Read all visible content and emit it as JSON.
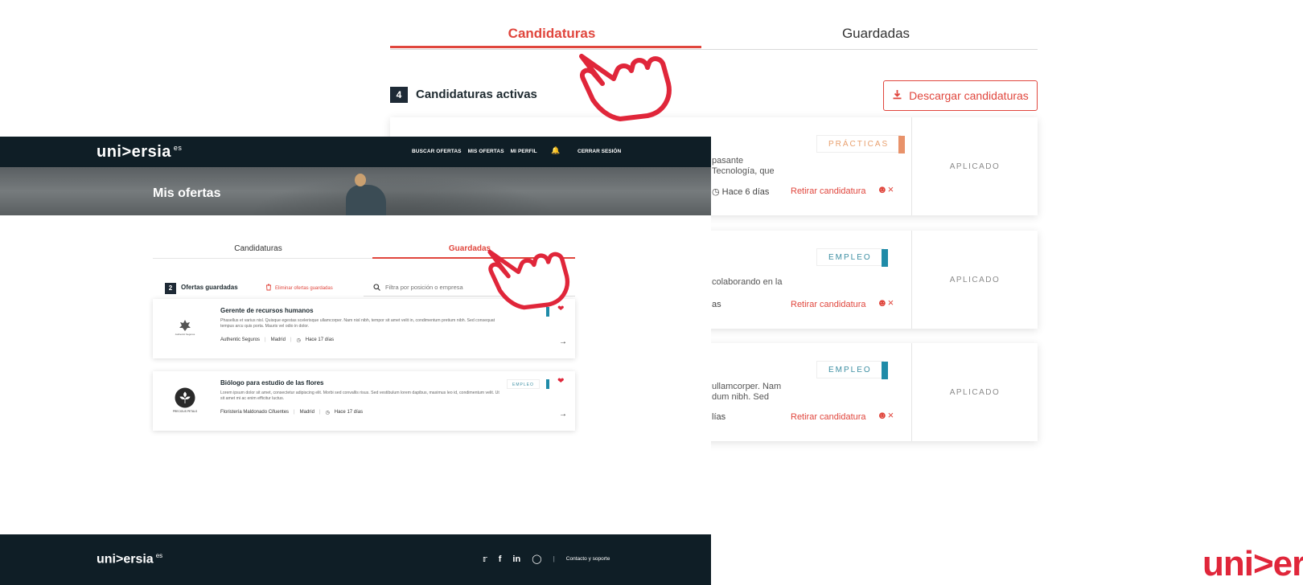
{
  "back": {
    "tabs": {
      "applications": "Candidaturas",
      "saved": "Guardadas"
    },
    "active_count": "4",
    "active_label": "Candidaturas activas",
    "download_label": "Descargar candidaturas",
    "cards": [
      {
        "badge": "PRÁCTICAS",
        "desc_line1": "pasante",
        "desc_line2": "Tecnología, que",
        "meta": "Hace 6 días",
        "withdraw": "Retirar candidatura",
        "status": "APLICADO"
      },
      {
        "badge": "EMPLEO",
        "desc_line1": "colaborando en la",
        "desc_line2": "",
        "meta": "as",
        "withdraw": "Retirar candidatura",
        "status": "APLICADO"
      },
      {
        "badge": "EMPLEO",
        "desc_line1": "ullamcorper. Nam",
        "desc_line2": "dum nibh. Sed",
        "meta": "lías",
        "withdraw": "Retirar candidatura",
        "status": "APLICADO"
      }
    ],
    "brand": "uni>ersi"
  },
  "front": {
    "nav": {
      "logo": "uni>ersia",
      "logo_sup": "es",
      "links": [
        "BUSCAR OFERTAS",
        "MIS OFERTAS",
        "MI PERFIL"
      ],
      "logout": "CERRAR SESIÓN"
    },
    "hero_title": "Mis ofertas",
    "tabs": {
      "applications": "Candidaturas",
      "saved": "Guardadas"
    },
    "saved_count": "2",
    "saved_label": "Ofertas guardadas",
    "delete_saved": "Eliminar ofertas guardadas",
    "search_placeholder": "Filtra por posición o empresa",
    "jobs": [
      {
        "title": "Gerente de recursos humanos",
        "desc": "Phasellus et varius nisl. Quisque egestas scelerisque ullamcorper. Nam nisl nibh, tempor sit amet velit in, condimentum pretium nibh. Sed consequat tempus arcu quis porta. Mauris vel odio in dolor.",
        "company": "Authentic Seguros",
        "city": "Madrid",
        "time": "Hace 17 días",
        "logo_text": "Authentic Seguros",
        "badge": ""
      },
      {
        "title": "Biólogo para estudio de las flores",
        "desc": "Lorem ipsum dolor sit amet, consectetur adipiscing elit. Morbi sed convallis risus. Sed vestibulum lorem dapibus, maximus leo id, condimentum velit. Ut sit amet mi ac enim efficitur luctus.",
        "company": "Floristería Maldonado Cifuentes",
        "city": "Madrid",
        "time": "Hace 17 días",
        "logo_text": "PRECIOUS PETALS",
        "badge": "EMPLEO"
      }
    ],
    "footer": {
      "logo": "uni>ersia",
      "logo_sup": "es",
      "contact": "Contacto y soporte"
    }
  },
  "colors": {
    "accent": "#e0463d",
    "navy": "#0f1e26",
    "brand_red": "#e0263a",
    "practicas": "#e8926a",
    "empleo": "#1f8ba8"
  }
}
